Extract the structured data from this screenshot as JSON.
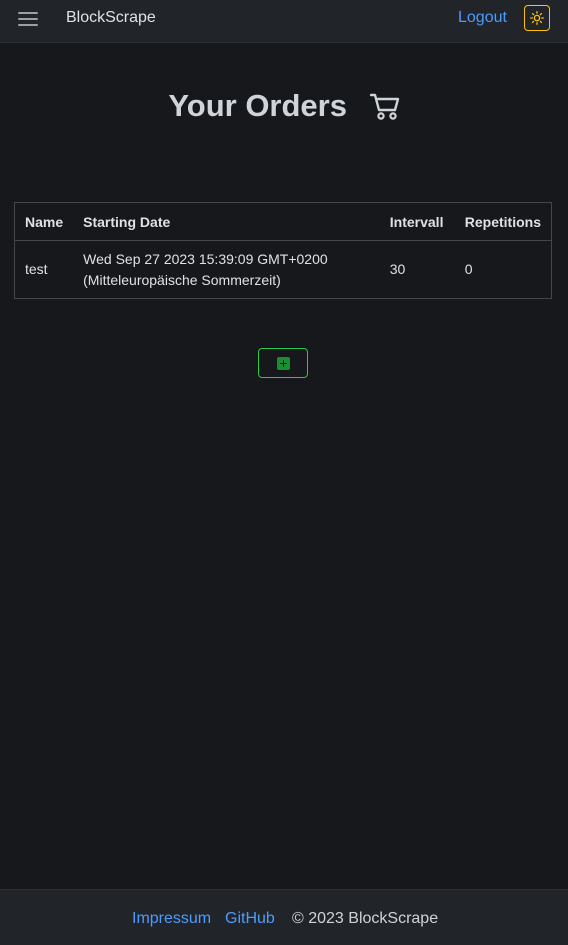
{
  "navbar": {
    "brand": "BlockScrape",
    "logout_label": "Logout",
    "menu_icon": "hamburger-icon",
    "theme_icon": "sun-icon",
    "theme_color": "#ffc107",
    "link_color": "#4c9cff"
  },
  "main": {
    "title": "Your Orders",
    "title_icon": "cart-icon",
    "table": {
      "columns": [
        "Name",
        "Starting Date",
        "Intervall",
        "Repetitions"
      ],
      "rows": [
        {
          "name": "test",
          "starting_date_line1": "Wed Sep 27 2023 15:39:09 GMT+0200",
          "starting_date_line2": "(Mitteleuropäische Sommerzeit)",
          "intervall": "30",
          "repetitions": "0"
        }
      ]
    },
    "add_button_icon": "plus-square-icon",
    "add_button_color": "#29c94a"
  },
  "footer": {
    "links": [
      "Impressum",
      "GitHub"
    ],
    "copyright": "© 2023 BlockScrape"
  }
}
